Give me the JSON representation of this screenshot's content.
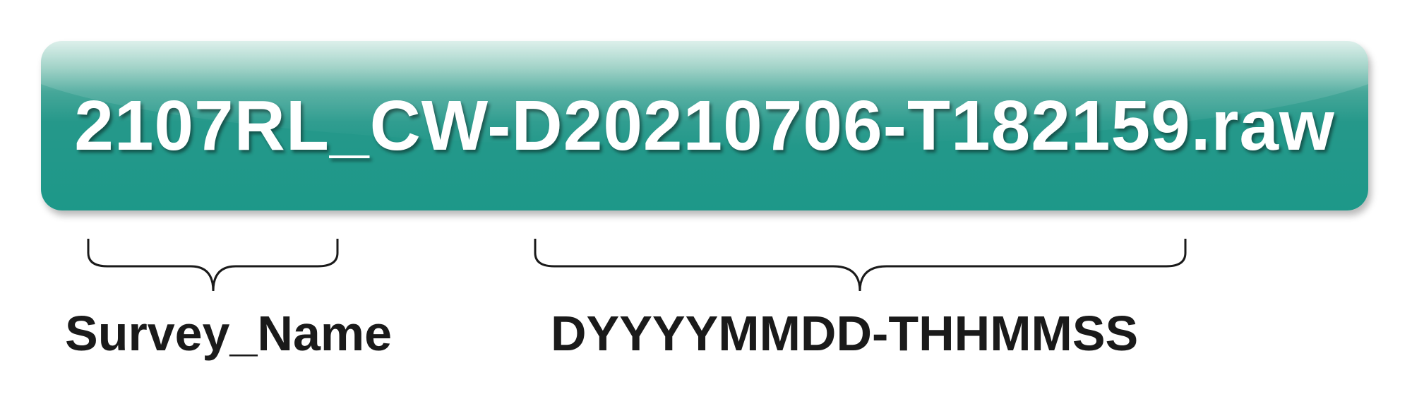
{
  "banner": {
    "filename": "2107RL_CW-D20210706-T182159.raw",
    "color": "#1d9889"
  },
  "labels": {
    "left": "Survey_Name",
    "right": "DYYYYMMDD-THHMMSS"
  }
}
